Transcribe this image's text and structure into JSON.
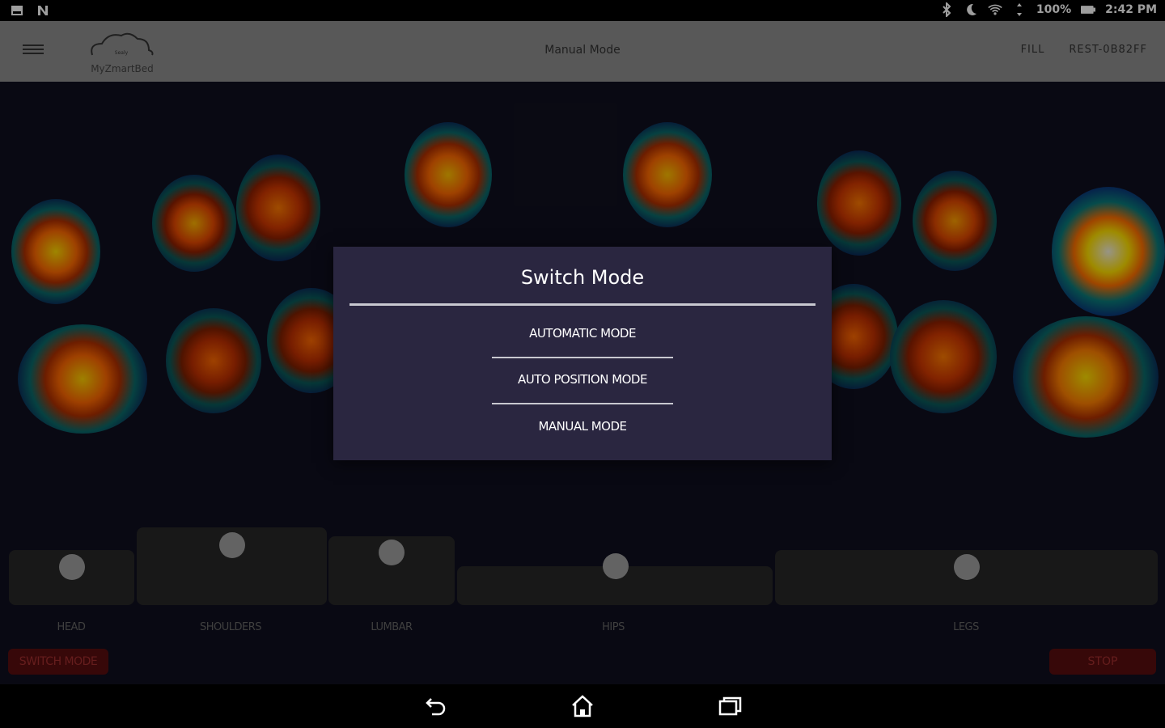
{
  "status_bar": {
    "battery": "100%",
    "time": "2:42 PM",
    "left_icons": [
      "gallery-icon",
      "n-icon"
    ],
    "right_icons": [
      "bluetooth-icon",
      "moon-icon",
      "wifi-icon",
      "data-icon",
      "battery-icon"
    ]
  },
  "app_bar": {
    "logo_text": "MyZmartBed",
    "logo_small": "Sealy",
    "title": "Manual Mode",
    "right_items": [
      "FILL",
      "REST-0B82FF"
    ]
  },
  "zones": [
    {
      "label": "HEAD",
      "level": 0.45
    },
    {
      "label": "SHOULDERS",
      "level": 0.95
    },
    {
      "label": "LUMBAR",
      "level": 0.75
    },
    {
      "label": "HIPS",
      "level": 0.45
    },
    {
      "label": "LEGS",
      "level": 0.45
    }
  ],
  "buttons": {
    "switch_mode": "SWITCH MODE",
    "stop": "STOP"
  },
  "dialog": {
    "title": "Switch Mode",
    "options": [
      "AUTOMATIC MODE",
      "AUTO POSITION MODE",
      "MANUAL MODE"
    ]
  },
  "nav_bar": {
    "icons": [
      "back-icon",
      "home-icon",
      "recents-icon"
    ]
  },
  "colors": {
    "background": "#10101f",
    "app_bar": "#8f8f8f",
    "dialog": "#2a2640",
    "button": "#5a0e10",
    "button_text": "#a43030"
  }
}
